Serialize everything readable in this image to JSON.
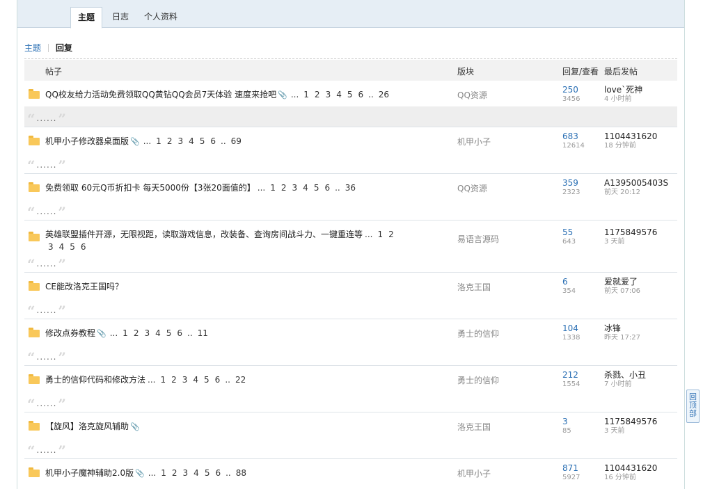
{
  "tabs": [
    {
      "label": "主题",
      "active": true
    },
    {
      "label": "日志",
      "active": false
    },
    {
      "label": "个人资料",
      "active": false
    }
  ],
  "subnav": {
    "link": "主题",
    "current": "回复"
  },
  "table_header": {
    "post": "帖子",
    "forum": "版块",
    "stats": "回复/查看",
    "last": "最后发帖"
  },
  "reply_placeholder": "......",
  "back_to_top": "回顶部",
  "threads": [
    {
      "title": "QQ校友给力活动免费领取QQ黄钻QQ会员7天体验 速度来抢吧",
      "attach": true,
      "pages": [
        "1",
        "2",
        "3",
        "4",
        "5",
        "6"
      ],
      "last_page": "26",
      "forum": "QQ资源",
      "replies": "250",
      "views": "3456",
      "last_user": "love`死神",
      "last_time": "4 小时前",
      "tall": false,
      "grey_reply": true
    },
    {
      "title": "机甲小子修改器桌面版",
      "attach": true,
      "pages": [
        "1",
        "2",
        "3",
        "4",
        "5",
        "6"
      ],
      "last_page": "69",
      "forum": "机甲小子",
      "replies": "683",
      "views": "12614",
      "last_user": "1104431620",
      "last_time": "18 分钟前",
      "tall": false,
      "grey_reply": false
    },
    {
      "title": "免费领取 60元Q币折扣卡 每天5000份【3张20面值的】",
      "attach": false,
      "pages": [
        "1",
        "2",
        "3",
        "4",
        "5",
        "6"
      ],
      "last_page": "36",
      "forum": "QQ资源",
      "replies": "359",
      "views": "2323",
      "last_user": "A1395005403S",
      "last_time": "前天 20:12",
      "tall": false,
      "grey_reply": false
    },
    {
      "title": "英雄联盟插件开源，无限视距，读取游戏信息，改装备、查询房间战斗力、一键重连等",
      "attach": false,
      "pages": [
        "1",
        "2",
        "3",
        "4",
        "5",
        "6"
      ],
      "last_page": "",
      "forum": "易语言源码",
      "replies": "55",
      "views": "643",
      "last_user": "1175849576",
      "last_time": "3 天前",
      "tall": true,
      "grey_reply": false
    },
    {
      "title": "CE能改洛克王国吗？",
      "attach": false,
      "pages": [],
      "last_page": "",
      "forum": "洛克王国",
      "replies": "6",
      "views": "354",
      "last_user": "爱就爱了",
      "last_time": "前天 07:06",
      "tall": false,
      "grey_reply": false
    },
    {
      "title": "修改点券教程",
      "attach": true,
      "pages": [
        "1",
        "2",
        "3",
        "4",
        "5",
        "6"
      ],
      "last_page": "11",
      "forum": "勇士的信仰",
      "replies": "104",
      "views": "1338",
      "last_user": "冰锋",
      "last_time": "昨天 17:27",
      "tall": false,
      "grey_reply": false
    },
    {
      "title": "勇士的信仰代码和修改方法",
      "attach": false,
      "pages": [
        "1",
        "2",
        "3",
        "4",
        "5",
        "6"
      ],
      "last_page": "22",
      "forum": "勇士的信仰",
      "replies": "212",
      "views": "1554",
      "last_user": "杀戮、小丑",
      "last_time": "7 小时前",
      "tall": false,
      "grey_reply": false
    },
    {
      "title": "【旋风】洛克旋风辅助",
      "attach": true,
      "pages": [],
      "last_page": "",
      "forum": "洛克王国",
      "replies": "3",
      "views": "85",
      "last_user": "1175849576",
      "last_time": "3 天前",
      "tall": false,
      "grey_reply": false
    },
    {
      "title": "机甲小子魔神辅助2.0版",
      "attach": true,
      "pages": [
        "1",
        "2",
        "3",
        "4",
        "5",
        "6"
      ],
      "last_page": "88",
      "forum": "机甲小子",
      "replies": "871",
      "views": "5927",
      "last_user": "1104431620",
      "last_time": "16 分钟前",
      "tall": false,
      "grey_reply": false
    }
  ]
}
